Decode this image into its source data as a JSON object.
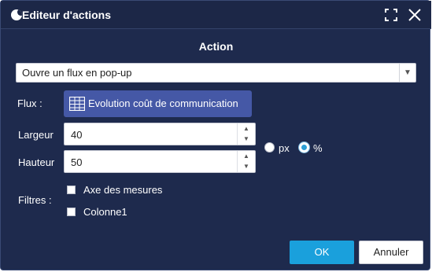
{
  "window": {
    "title": "Editeur d'actions"
  },
  "section": {
    "title": "Action"
  },
  "action_select": {
    "value": "Ouvre un flux en pop-up"
  },
  "flux": {
    "label": "Flux :",
    "button_label": "Evolution coût de communication"
  },
  "width": {
    "label": "Largeur",
    "value": "40"
  },
  "height": {
    "label": "Hauteur",
    "value": "50"
  },
  "units": {
    "options": [
      "px",
      "%"
    ],
    "selected": "%"
  },
  "filters": {
    "label": "Filtres :",
    "items": [
      {
        "label": "Axe des mesures",
        "checked": false
      },
      {
        "label": "Colonne1",
        "checked": false
      }
    ]
  },
  "buttons": {
    "ok": "OK",
    "cancel": "Annuler"
  },
  "colors": {
    "background": "#1e2a4d",
    "primary": "#1aa0dc",
    "flux_button": "#4558a6"
  }
}
